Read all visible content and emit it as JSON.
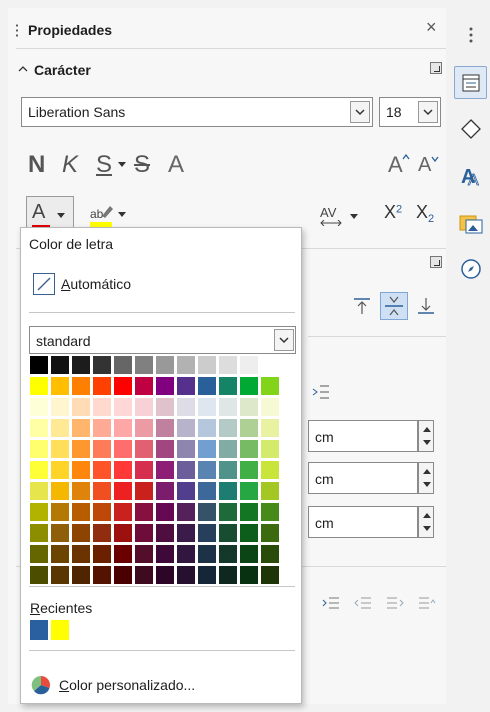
{
  "panel": {
    "title": "Propiedades",
    "close": "×"
  },
  "character": {
    "title": "Carácter",
    "font_name": "Liberation Sans",
    "font_size": "18",
    "bold": "N",
    "italic": "K",
    "underline": "S",
    "strike": "S",
    "shadow": "A",
    "grow": "A",
    "shrink": "A",
    "spacing": "AV",
    "superscript_base": "X",
    "superscript_exp": "2",
    "subscript_base": "X",
    "subscript_exp": "2"
  },
  "background_fields": [
    {
      "value": "cm"
    },
    {
      "value": "cm"
    },
    {
      "value": "cm"
    }
  ],
  "color_popup": {
    "title": "Color de letra",
    "automatic_first": "A",
    "automatic_rest": "utomático",
    "palette": "standard",
    "recent_first": "R",
    "recent_rest": "ecientes",
    "recent_colors": [
      "#2a5fa0",
      "#ffff00"
    ],
    "custom_first": "C",
    "custom_rest": "olor personalizado...",
    "colors": [
      "#000000",
      "#111111",
      "#1c1c1c",
      "#333333",
      "#666666",
      "#808080",
      "#999999",
      "#b2b2b2",
      "#cccccc",
      "#dddddd",
      "#eeeeee",
      "#ffffff",
      "#ffff00",
      "#ffbf00",
      "#ff8000",
      "#ff4000",
      "#ff0000",
      "#bf0041",
      "#800080",
      "#55308d",
      "#2a6099",
      "#158466",
      "#00a933",
      "#81d41a",
      "#ffffd7",
      "#fff5ce",
      "#ffdbb6",
      "#ffd8ce",
      "#ffd7d7",
      "#f7d1d5",
      "#e0c2cd",
      "#dedce6",
      "#dee6ef",
      "#dee7e5",
      "#dde8cb",
      "#f6f9d4",
      "#ffffa6",
      "#ffe994",
      "#ffb66c",
      "#ffaa95",
      "#ffa6a6",
      "#ec9ba4",
      "#bf819e",
      "#b7b3ca",
      "#b4c7dc",
      "#b3cac7",
      "#afd095",
      "#e8f2a1",
      "#ffff6d",
      "#ffde59",
      "#ff972f",
      "#ff7b59",
      "#ff6d6d",
      "#e16173",
      "#a1467e",
      "#8e86ae",
      "#729fcf",
      "#81aca6",
      "#77bc65",
      "#d4ea6b",
      "#ffff38",
      "#ffd428",
      "#ff860d",
      "#ff5429",
      "#ff3838",
      "#d62e4e",
      "#8d1d75",
      "#6b5e9b",
      "#5983b0",
      "#50938a",
      "#3faf46",
      "#c9e53b",
      "#e6e64c",
      "#f5b800",
      "#e0830b",
      "#ef4f21",
      "#ed2121",
      "#c9211e",
      "#7b1c6d",
      "#513e8c",
      "#3c6999",
      "#1e7d71",
      "#27a744",
      "#a5c724",
      "#b2b200",
      "#b47804",
      "#b85c00",
      "#be480a",
      "#c9211e",
      "#861141",
      "#650953",
      "#55215b",
      "#355269",
      "#1e6a39",
      "#127622",
      "#468a1a",
      "#8d8d00",
      "#8f5e08",
      "#8c4400",
      "#8f2d0e",
      "#9c1010",
      "#6e0d39",
      "#4f0e40",
      "#3b1b4a",
      "#283f5b",
      "#184d31",
      "#0e5e1b",
      "#3b6b0e",
      "#666600",
      "#6b4400",
      "#6b3300",
      "#6b2000",
      "#6b0000",
      "#540e2c",
      "#3e0939",
      "#311740",
      "#1e3247",
      "#14382a",
      "#0c4515",
      "#294c0b",
      "#4d4d00",
      "#5a3600",
      "#4f2500",
      "#541300",
      "#4a0000",
      "#3d0a20",
      "#2d0527",
      "#26102f",
      "#162638",
      "#0e2820",
      "#073110",
      "#1d3507"
    ]
  }
}
